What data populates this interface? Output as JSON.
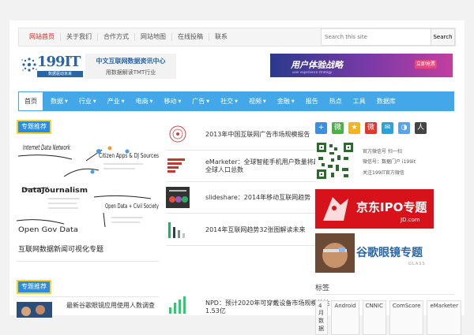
{
  "topbar": {
    "links": [
      "网站首页",
      "关于我们",
      "合作方式",
      "网站地图",
      "在线投稿",
      "联系"
    ],
    "search_placeholder": "Search this site",
    "search_button": "Search"
  },
  "logo": {
    "brand": "199IT",
    "sub": "数据驱动未来",
    "line1": "中文互联网数据资讯中心",
    "line2": "用数据解读TMT行业"
  },
  "banner": {
    "title": "用户体验战略",
    "subtitle": "user experience strategy",
    "button": "立即抢票"
  },
  "nav": {
    "home": "首页",
    "items": [
      "数据",
      "行业",
      "产业",
      "电商",
      "移动",
      "广告",
      "社交",
      "视频",
      "金融",
      "报告",
      "热点",
      "工具",
      "数据库"
    ]
  },
  "featured": {
    "label": "专题推荐",
    "caption": "互联网数据新闻可视化专题",
    "diagram": {
      "a": "Internet Data Network",
      "b": "Citizen Apps & DJ Sources",
      "c": "DataJournalism",
      "d": "Open Data + Civil Society",
      "e": "Open Gov Data"
    }
  },
  "articles": [
    {
      "title": "2013年中国互联网广告市场规模报告"
    },
    {
      "title": "eMarketer：全球智能手机用户数量将超过全球人口总数"
    },
    {
      "title": "slideshare：2014年移动互联网趋势"
    },
    {
      "title": "2014年互联网趋势32张图解读未来"
    }
  ],
  "section2": {
    "label": "专题推荐",
    "left_title": "最新谷歌眼镜应用使用人数调查",
    "right_title": "NPD：预计2020年可穿戴设备市场规模将达1.53亿"
  },
  "sidebar": {
    "social": [
      "+",
      "微",
      "★",
      "微",
      "✉",
      "◑",
      "人"
    ],
    "qr_lines": [
      "官方微信号 扫一扫",
      "微信号：数据门户 i199it",
      "关注199IT官方微信"
    ],
    "jd": {
      "title": "京东IPO专题",
      "sub": "JD.com"
    },
    "glass": {
      "title": "谷歌眼镜专题",
      "sub": "GLASS"
    },
    "tags_title": "标签",
    "tags": [
      "4月数据",
      "Android",
      "CNNIC",
      "ComScore",
      "eMarketer"
    ]
  },
  "colors": {
    "nav": "#44a8e8",
    "label": "#2b8be0",
    "label_border": "#ffd21f",
    "active": "#d9241b"
  }
}
